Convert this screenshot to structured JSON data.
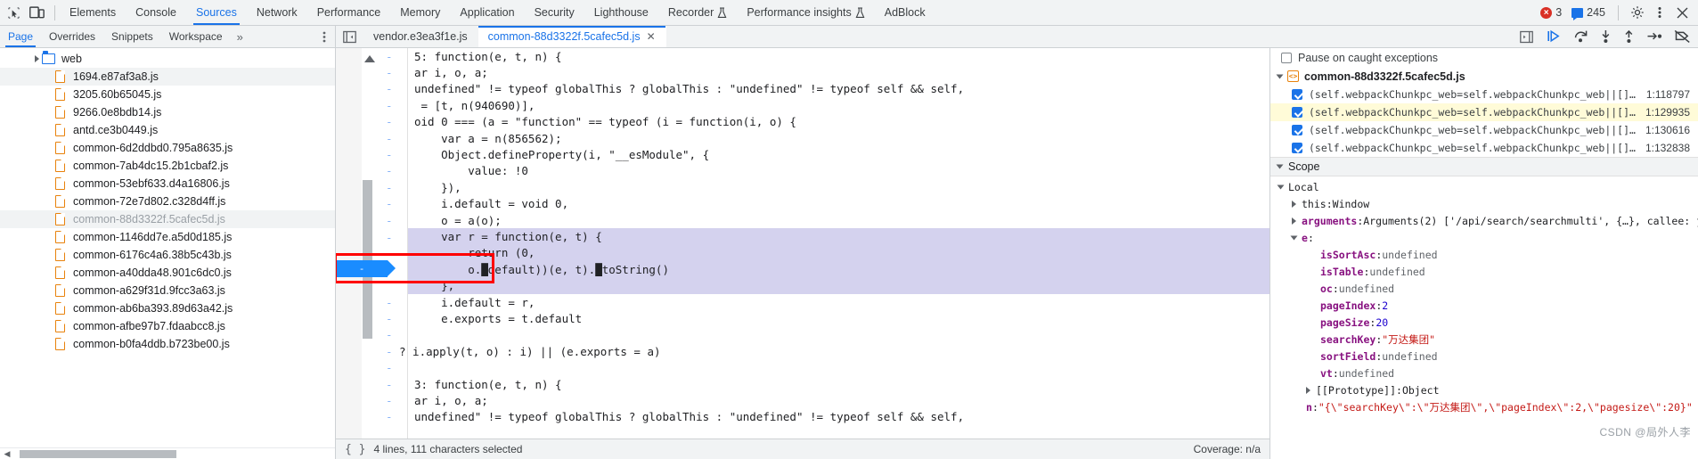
{
  "toolbar": {
    "icons": [
      "inspect-icon",
      "device-toolbar-icon"
    ],
    "tabs": [
      {
        "label": "Elements",
        "active": false,
        "flask": false
      },
      {
        "label": "Console",
        "active": false,
        "flask": false
      },
      {
        "label": "Sources",
        "active": true,
        "flask": false
      },
      {
        "label": "Network",
        "active": false,
        "flask": false
      },
      {
        "label": "Performance",
        "active": false,
        "flask": false
      },
      {
        "label": "Memory",
        "active": false,
        "flask": false
      },
      {
        "label": "Application",
        "active": false,
        "flask": false
      },
      {
        "label": "Security",
        "active": false,
        "flask": false
      },
      {
        "label": "Lighthouse",
        "active": false,
        "flask": false
      },
      {
        "label": "Recorder",
        "active": false,
        "flask": true
      },
      {
        "label": "Performance insights",
        "active": false,
        "flask": true
      },
      {
        "label": "AdBlock",
        "active": false,
        "flask": false
      }
    ],
    "error_count": "3",
    "message_count": "245",
    "settings_label": "gear-icon",
    "more_label": "kebab-icon",
    "close_label": "✕"
  },
  "navigator": {
    "tabs": [
      {
        "label": "Page",
        "active": true
      },
      {
        "label": "Overrides",
        "active": false
      },
      {
        "label": "Snippets",
        "active": false
      },
      {
        "label": "Workspace",
        "active": false
      }
    ],
    "more_label": "»",
    "tree": [
      {
        "name": "web",
        "type": "folder",
        "selected": false,
        "dim": false
      },
      {
        "name": "1694.e87af3a8.js",
        "type": "file",
        "selected": true,
        "dim": false
      },
      {
        "name": "3205.60b65045.js",
        "type": "file",
        "selected": false,
        "dim": false
      },
      {
        "name": "9266.0e8bdb14.js",
        "type": "file",
        "selected": false,
        "dim": false
      },
      {
        "name": "antd.ce3b0449.js",
        "type": "file",
        "selected": false,
        "dim": false
      },
      {
        "name": "common-6d2ddbd0.795a8635.js",
        "type": "file",
        "selected": false,
        "dim": false
      },
      {
        "name": "common-7ab4dc15.2b1cbaf2.js",
        "type": "file",
        "selected": false,
        "dim": false
      },
      {
        "name": "common-53ebf633.d4a16806.js",
        "type": "file",
        "selected": false,
        "dim": false
      },
      {
        "name": "common-72e7d802.c328d4ff.js",
        "type": "file",
        "selected": false,
        "dim": false
      },
      {
        "name": "common-88d3322f.5cafec5d.js",
        "type": "file",
        "selected": true,
        "dim": true
      },
      {
        "name": "common-1146dd7e.a5d0d185.js",
        "type": "file",
        "selected": false,
        "dim": false
      },
      {
        "name": "common-6176c4a6.38b5c43b.js",
        "type": "file",
        "selected": false,
        "dim": false
      },
      {
        "name": "common-a40dda48.901c6dc0.js",
        "type": "file",
        "selected": false,
        "dim": false
      },
      {
        "name": "common-a629f31d.9fcc3a63.js",
        "type": "file",
        "selected": false,
        "dim": false
      },
      {
        "name": "common-ab6ba393.89d63a42.js",
        "type": "file",
        "selected": false,
        "dim": false
      },
      {
        "name": "common-afbe97b7.fdaabcc8.js",
        "type": "file",
        "selected": false,
        "dim": false
      },
      {
        "name": "common-b0fa4ddb.b723be00.js",
        "type": "file",
        "selected": false,
        "dim": false
      }
    ]
  },
  "editor": {
    "tabs": [
      {
        "label": "vendor.e3ea3f1e.js",
        "active": false,
        "closable": false
      },
      {
        "label": "common-88d3322f.5cafec5d.js",
        "active": true,
        "closable": true
      }
    ],
    "close_glyph": "✕",
    "lines": [
      "5: function(e, t, n) {",
      "ar i, o, a;",
      "undefined\" != typeof globalThis ? globalThis : \"undefined\" != typeof self && self,",
      " = [t, n(940690)],",
      "oid 0 === (a = \"function\" == typeof (i = function(i, o) {",
      "    var a = n(856562);",
      "    Object.defineProperty(i, \"__esModule\", {",
      "        value: !0",
      "    }),",
      "    i.default = void 0,",
      "    o = a(o);",
      "    var r = function(e, t) {",
      "        return (0,",
      "        o.█default))(e, t).█toString()",
      "    },",
      "    i.default = r,",
      "    e.exports = t.default",
      "",
      "? i.apply(t, o) : i) || (e.exports = a)",
      "",
      "3: function(e, t, n) {",
      "ar i, o, a;",
      "undefined\" != typeof globalThis ? globalThis : \"undefined\" != typeof self && self,"
    ],
    "gutter_dash": "-",
    "breakpoint_chip_label": "-",
    "status": {
      "format_icon": "{ }",
      "selection_info": "4 lines, 111 characters selected",
      "coverage": "Coverage: n/a"
    }
  },
  "debugger": {
    "toolbar_icons": [
      "resume-icon",
      "step-over-icon",
      "step-into-icon",
      "step-out-icon",
      "step-icon",
      "deactivate-breakpoints-icon"
    ],
    "pause_on_caught": {
      "label": "Pause on caught exceptions",
      "checked": false
    },
    "breakpoints": {
      "file": "common-88d3322f.5cafec5d.js",
      "items": [
        {
          "snippet": "(self.webpackChunkpc_web=self.webpackChunkpc_web||[]…",
          "line": "1:118797",
          "checked": true,
          "current": false
        },
        {
          "snippet": "(self.webpackChunkpc_web=self.webpackChunkpc_web||[]…",
          "line": "1:129935",
          "checked": true,
          "current": true
        },
        {
          "snippet": "(self.webpackChunkpc_web=self.webpackChunkpc_web||[]…",
          "line": "1:130616",
          "checked": true,
          "current": false
        },
        {
          "snippet": "(self.webpackChunkpc_web=self.webpackChunkpc_web||[]…",
          "line": "1:132838",
          "checked": true,
          "current": false
        }
      ]
    },
    "scope": {
      "header": "Scope",
      "local_label": "Local",
      "entries": [
        {
          "indent": 1,
          "expander": "closed",
          "key": "this",
          "keybold": false,
          "sep": ": ",
          "value": "Window",
          "vclass": "v-obj"
        },
        {
          "indent": 1,
          "expander": "closed",
          "key": "arguments",
          "keybold": true,
          "sep": ": ",
          "value": "Arguments(2) ['/api/search/searchmulti', {…}, callee: ƒ",
          "vclass": "v-obj"
        },
        {
          "indent": 1,
          "expander": "open",
          "key": "e",
          "keybold": true,
          "sep": ":",
          "value": "",
          "vclass": "v-obj"
        },
        {
          "indent": 3,
          "expander": "none",
          "key": "isSortAsc",
          "keybold": true,
          "sep": ": ",
          "value": "undefined",
          "vclass": "v-undef"
        },
        {
          "indent": 3,
          "expander": "none",
          "key": "isTable",
          "keybold": true,
          "sep": ": ",
          "value": "undefined",
          "vclass": "v-undef"
        },
        {
          "indent": 3,
          "expander": "none",
          "key": "oc",
          "keybold": true,
          "sep": ": ",
          "value": "undefined",
          "vclass": "v-undef"
        },
        {
          "indent": 3,
          "expander": "none",
          "key": "pageIndex",
          "keybold": true,
          "sep": ": ",
          "value": "2",
          "vclass": "v-num"
        },
        {
          "indent": 3,
          "expander": "none",
          "key": "pageSize",
          "keybold": true,
          "sep": ": ",
          "value": "20",
          "vclass": "v-num"
        },
        {
          "indent": 3,
          "expander": "none",
          "key": "searchKey",
          "keybold": true,
          "sep": ": ",
          "value": "\"万达集团\"",
          "vclass": "v-str"
        },
        {
          "indent": 3,
          "expander": "none",
          "key": "sortField",
          "keybold": true,
          "sep": ": ",
          "value": "undefined",
          "vclass": "v-undef"
        },
        {
          "indent": 3,
          "expander": "none",
          "key": "vt",
          "keybold": true,
          "sep": ": ",
          "value": "undefined",
          "vclass": "v-undef"
        },
        {
          "indent": 2,
          "expander": "closed",
          "key": "[[Prototype]]",
          "keybold": false,
          "sep": ": ",
          "value": "Object",
          "vclass": "v-obj"
        },
        {
          "indent": 2,
          "expander": "none",
          "key": "n",
          "keybold": true,
          "sep": ": ",
          "value": "\"{\\\"searchKey\\\":\\\"万达集团\\\",\\\"pageIndex\\\":2,\\\"pagesize\\\":20}\"",
          "vclass": "v-str"
        }
      ]
    }
  },
  "watermark": "CSDN @局外人李"
}
